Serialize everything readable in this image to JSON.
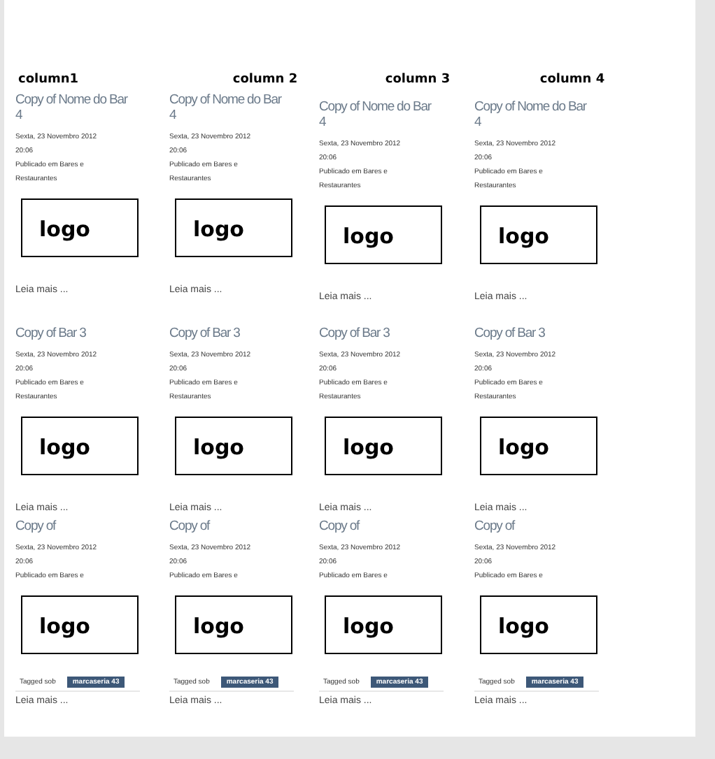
{
  "columns": [
    {
      "header": "column1",
      "posts": [
        {
          "title": "Copy of Nome do Bar 4",
          "date": "Sexta, 23 Novembro 2012 20:06",
          "published": "Publicado em Bares e Restaurantes",
          "logo": "logo",
          "more": "Leia mais ..."
        },
        {
          "title": "Copy of Bar 3",
          "date": "Sexta, 23 Novembro 2012 20:06",
          "published": "Publicado em Bares e Restaurantes",
          "logo": "logo",
          "more": "Leia mais ..."
        },
        {
          "title": "Copy of",
          "date": "Sexta, 23 Novembro 2012 20:06",
          "published": "Publicado em Bares e",
          "logo": "logo",
          "tagged": "Tagged sob",
          "tag": "marcaseria 43",
          "more": "Leia mais ..."
        }
      ]
    },
    {
      "header": "column 2",
      "posts": [
        {
          "title": "Copy of Nome do Bar 4",
          "date": "Sexta, 23 Novembro 2012 20:06",
          "published": "Publicado em Bares e Restaurantes",
          "logo": "logo",
          "more": "Leia mais ..."
        },
        {
          "title": "Copy of Bar 3",
          "date": "Sexta, 23 Novembro 2012 20:06",
          "published": "Publicado em Bares e Restaurantes",
          "logo": "logo",
          "more": "Leia mais ..."
        },
        {
          "title": "Copy of",
          "date": "Sexta, 23 Novembro 2012 20:06",
          "published": "Publicado em Bares e",
          "logo": "logo",
          "tagged": "Tagged sob",
          "tag": "marcaseria 43",
          "more": "Leia mais ..."
        }
      ]
    },
    {
      "header": "column 3",
      "posts": [
        {
          "title": "Copy of Nome do Bar 4",
          "date": "Sexta, 23 Novembro 2012 20:06",
          "published": "Publicado em Bares e Restaurantes",
          "logo": "logo",
          "more": "Leia mais ..."
        },
        {
          "title": "Copy of Bar 3",
          "date": "Sexta, 23 Novembro 2012 20:06",
          "published": "Publicado em Bares e Restaurantes",
          "logo": "logo",
          "more": "Leia mais ..."
        },
        {
          "title": "Copy of",
          "date": "Sexta, 23 Novembro 2012 20:06",
          "published": "Publicado em Bares e",
          "logo": "logo",
          "tagged": "Tagged sob",
          "tag": "marcaseria 43",
          "more": "Leia mais ..."
        }
      ]
    },
    {
      "header": "column 4",
      "posts": [
        {
          "title": "Copy of Nome do Bar 4",
          "date": "Sexta, 23 Novembro 2012 20:06",
          "published": "Publicado em Bares e Restaurantes",
          "logo": "logo",
          "more": "Leia mais ..."
        },
        {
          "title": "Copy of Bar 3",
          "date": "Sexta, 23 Novembro 2012 20:06",
          "published": "Publicado em Bares e Restaurantes",
          "logo": "logo",
          "more": "Leia mais ..."
        },
        {
          "title": "Copy of",
          "date": "Sexta, 23 Novembro 2012 20:06",
          "published": "Publicado em Bares e",
          "logo": "logo",
          "tagged": "Tagged sob",
          "tag": "marcaseria 43",
          "more": "Leia mais ..."
        }
      ]
    }
  ]
}
